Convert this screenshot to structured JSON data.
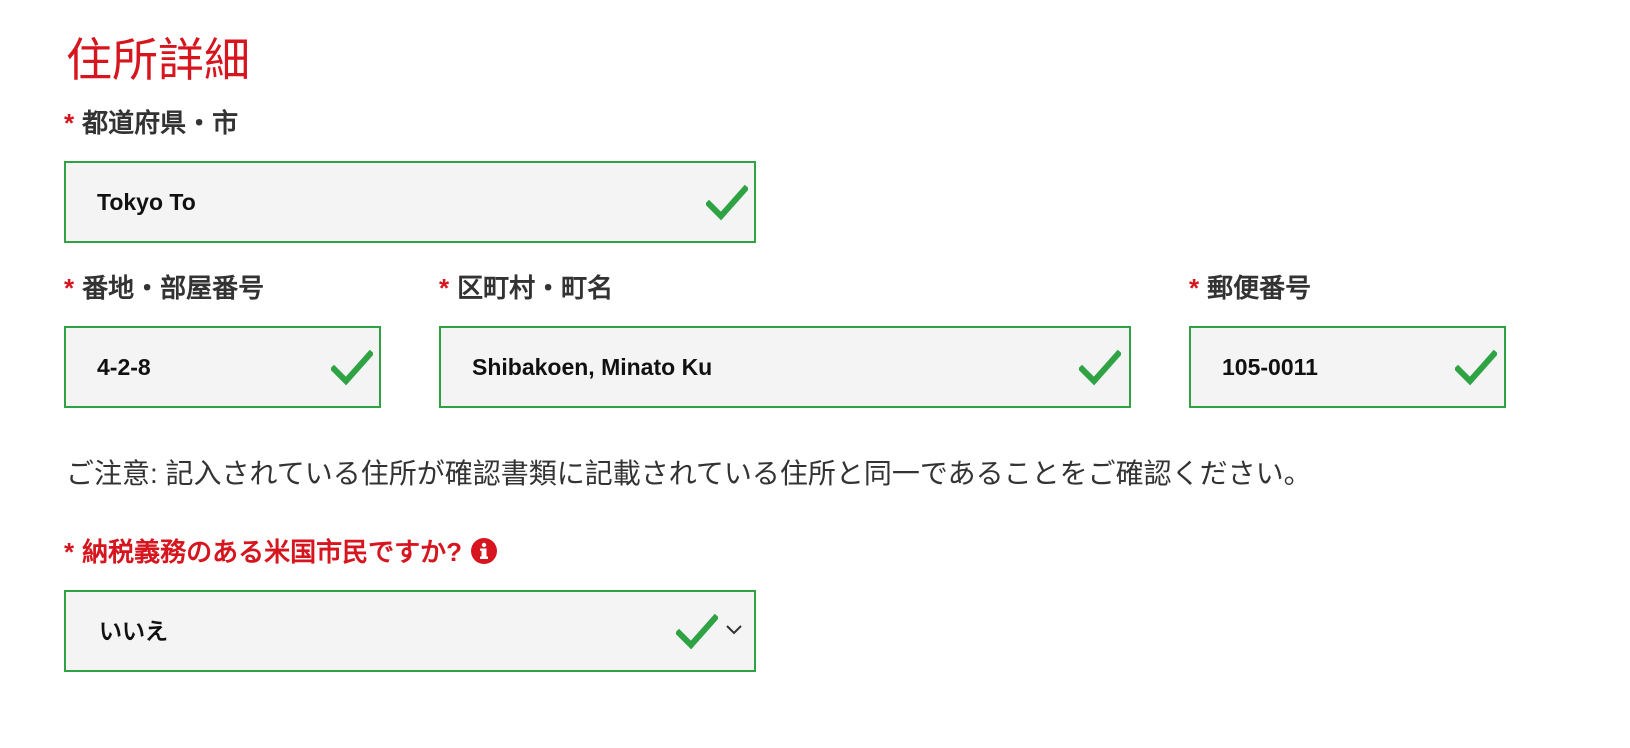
{
  "section": {
    "title": "住所詳細"
  },
  "required_mark": "*",
  "fields": {
    "prefecture_city": {
      "label": "都道府県・市",
      "value": "Tokyo To"
    },
    "street": {
      "label": "番地・部屋番号",
      "value": "4-2-8"
    },
    "town": {
      "label": "区町村・町名",
      "value": "Shibakoen, Minato Ku"
    },
    "postal_code": {
      "label": "郵便番号",
      "value": "105-0011"
    }
  },
  "note": "ご注意: 記入されている住所が確認書類に記載されている住所と同一であることをご確認ください。",
  "us_taxpayer": {
    "label": "納税義務のある米国市民ですか?",
    "value": "いいえ",
    "info_icon": "info-icon"
  },
  "colors": {
    "accent_red": "#d7151e",
    "valid_green": "#2fa343",
    "field_bg": "#f4f4f4"
  },
  "icons": {
    "valid": "checkmark-icon",
    "dropdown": "chevron-down-icon"
  }
}
